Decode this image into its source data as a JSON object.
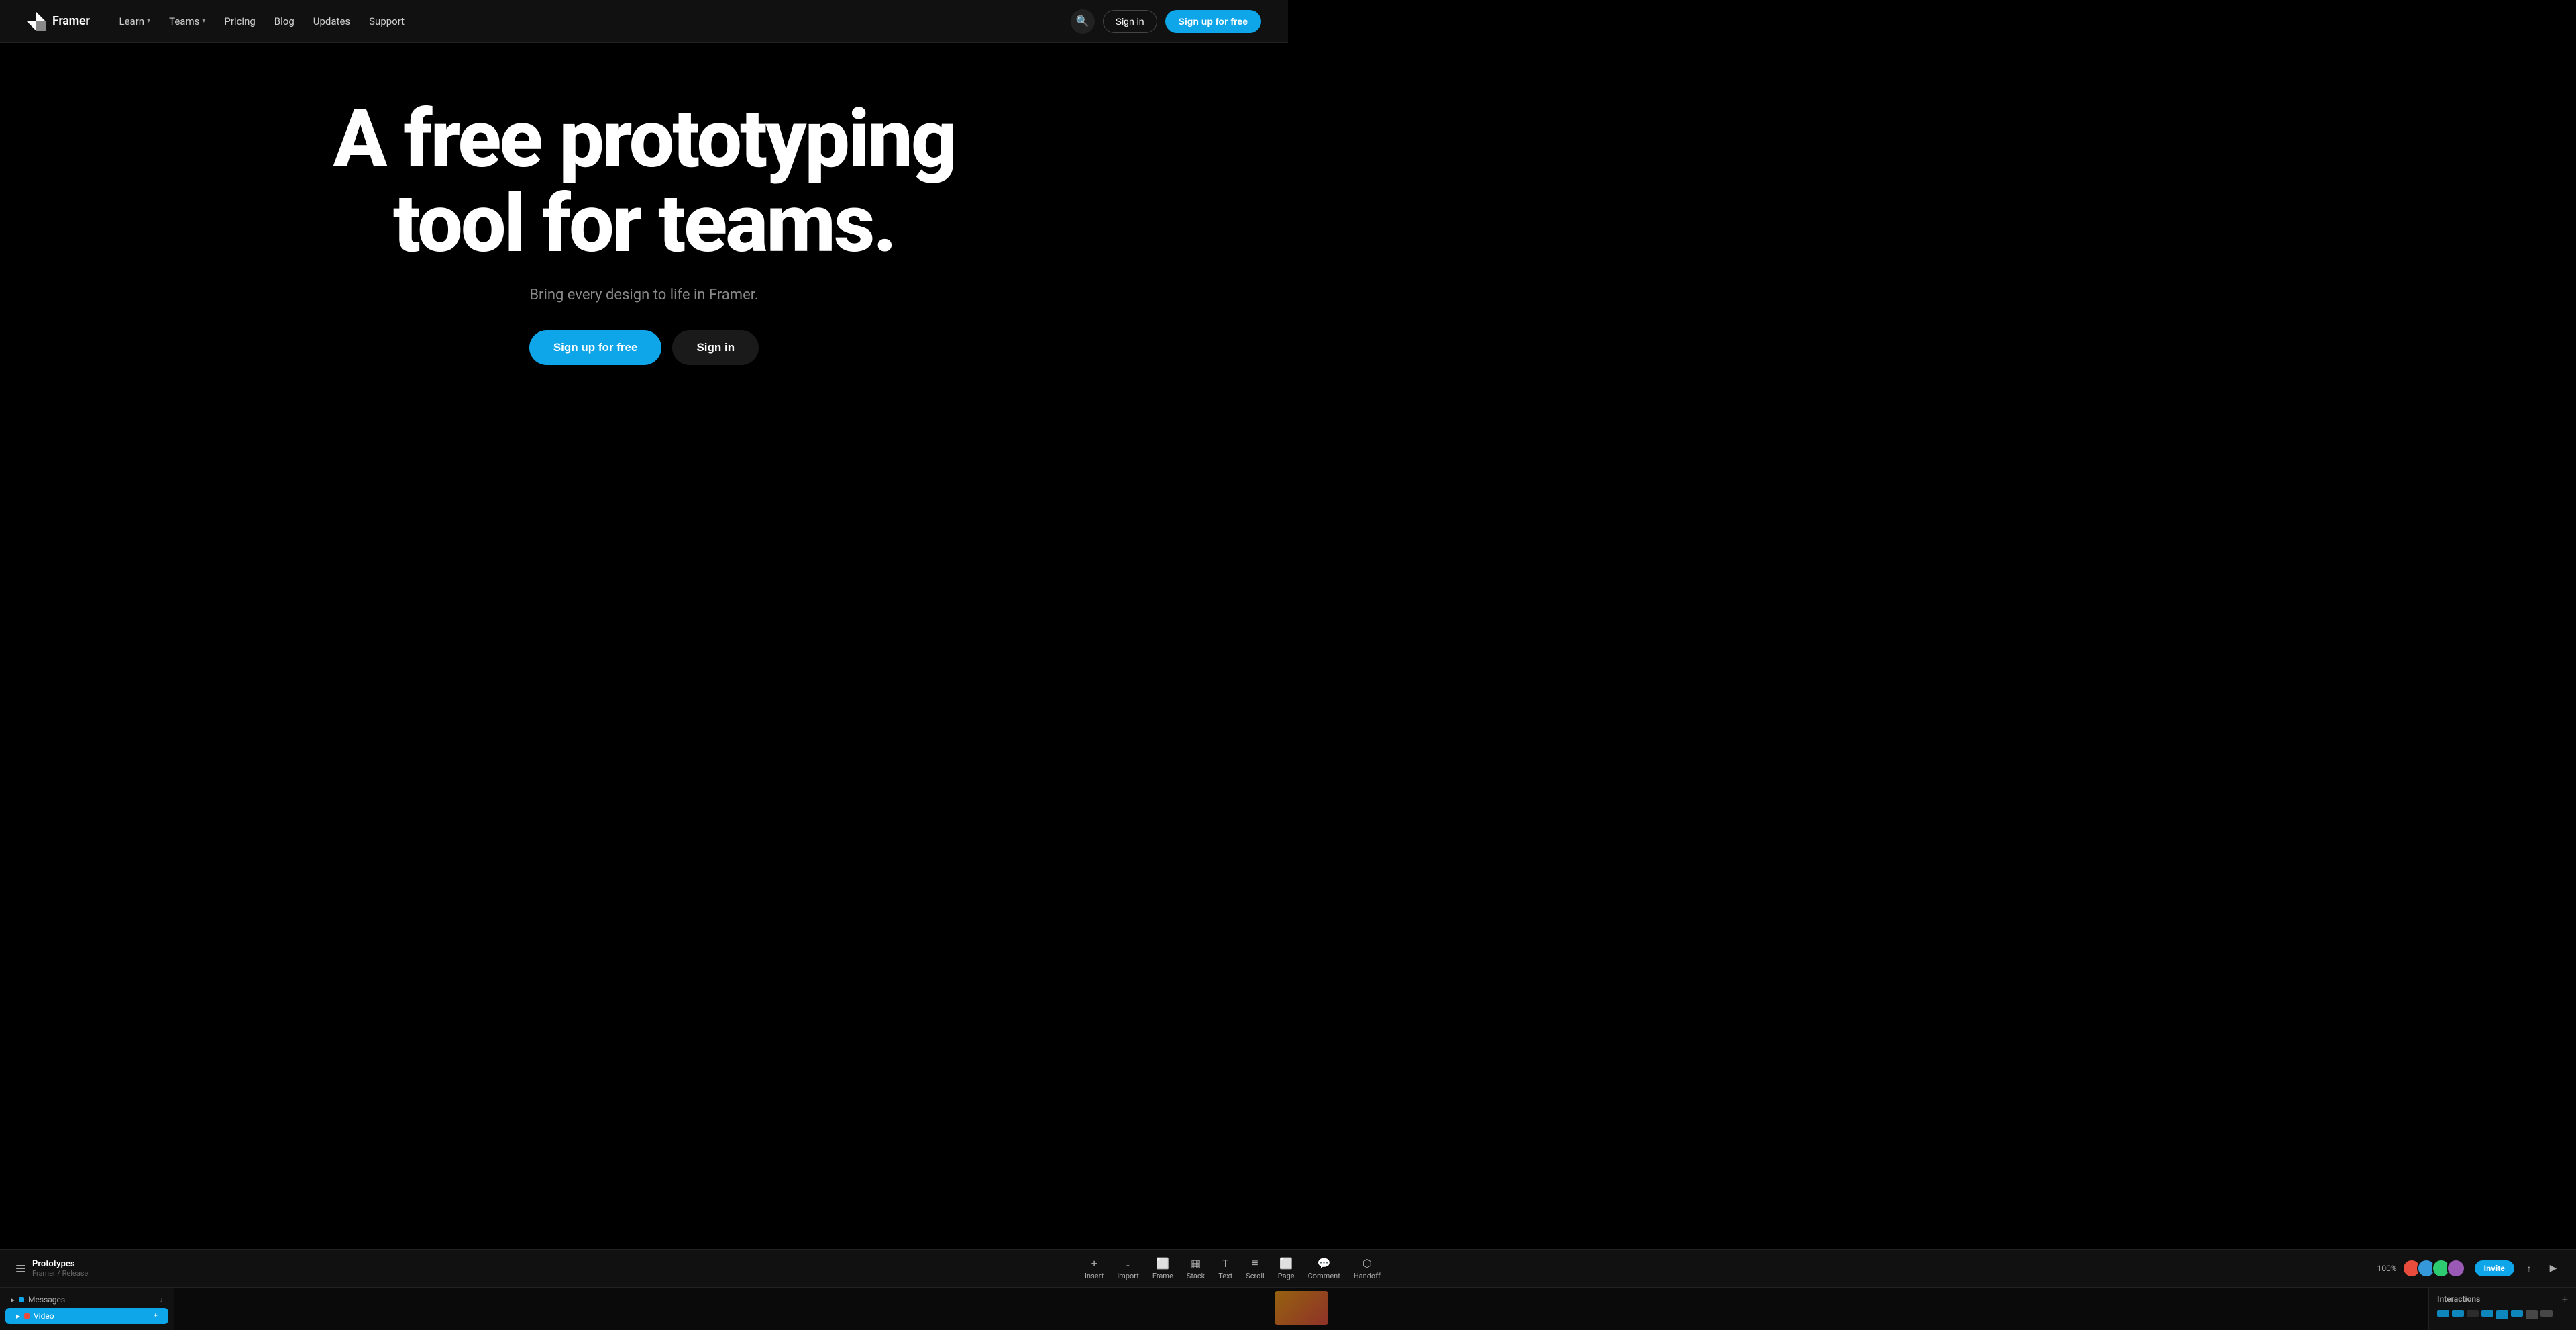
{
  "nav": {
    "logo_text": "Framer",
    "links": [
      {
        "label": "Learn",
        "has_dropdown": true
      },
      {
        "label": "Teams",
        "has_dropdown": true
      },
      {
        "label": "Pricing",
        "has_dropdown": false
      },
      {
        "label": "Blog",
        "has_dropdown": false
      },
      {
        "label": "Updates",
        "has_dropdown": false
      },
      {
        "label": "Support",
        "has_dropdown": false
      }
    ],
    "signin_label": "Sign in",
    "signup_label": "Sign up for free"
  },
  "hero": {
    "title": "A free prototyping tool for teams.",
    "subtitle": "Bring every design to life in Framer.",
    "signup_label": "Sign up for free",
    "signin_label": "Sign in"
  },
  "toolbar": {
    "project_name": "Prototypes",
    "project_path": "Framer / Release",
    "tools": [
      {
        "label": "Insert",
        "icon": "+"
      },
      {
        "label": "Import",
        "icon": "↓"
      },
      {
        "label": "Frame",
        "icon": "⬜"
      },
      {
        "label": "Stack",
        "icon": "▦"
      },
      {
        "label": "Text",
        "icon": "T"
      },
      {
        "label": "Scroll",
        "icon": "≡"
      },
      {
        "label": "Page",
        "icon": "⬜"
      },
      {
        "label": "Comment",
        "icon": "💬"
      },
      {
        "label": "Handoff",
        "icon": "⬡"
      }
    ],
    "zoom": "100%",
    "invite_label": "Invite"
  },
  "layers": {
    "items": [
      {
        "name": "Messages",
        "type": "frame",
        "active": false
      },
      {
        "name": "Video",
        "type": "video",
        "active": true
      }
    ]
  },
  "interactions": {
    "title": "Interactions",
    "add_icon": "+"
  },
  "colors": {
    "accent": "#0ea5e9",
    "bg": "#000000",
    "nav_bg": "#111111",
    "border": "#222222"
  }
}
